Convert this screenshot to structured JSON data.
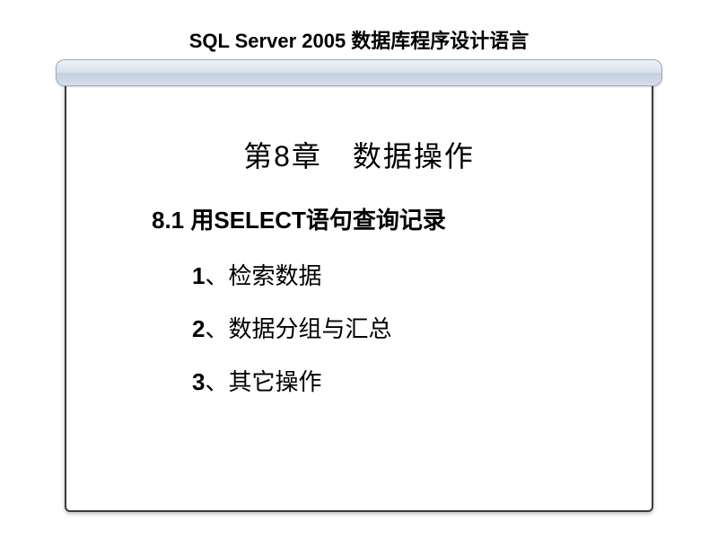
{
  "header": {
    "title": "SQL Server 2005 数据库程序设计语言"
  },
  "chapter": {
    "title": "第8章　数据操作"
  },
  "section": {
    "title": "8.1  用SELECT语句查询记录"
  },
  "items": [
    {
      "num": "1",
      "sep": "、",
      "text": "检索数据"
    },
    {
      "num": "2",
      "sep": "、",
      "text": "数据分组与汇总"
    },
    {
      "num": "3",
      "sep": "、",
      "text": "其它操作"
    }
  ]
}
